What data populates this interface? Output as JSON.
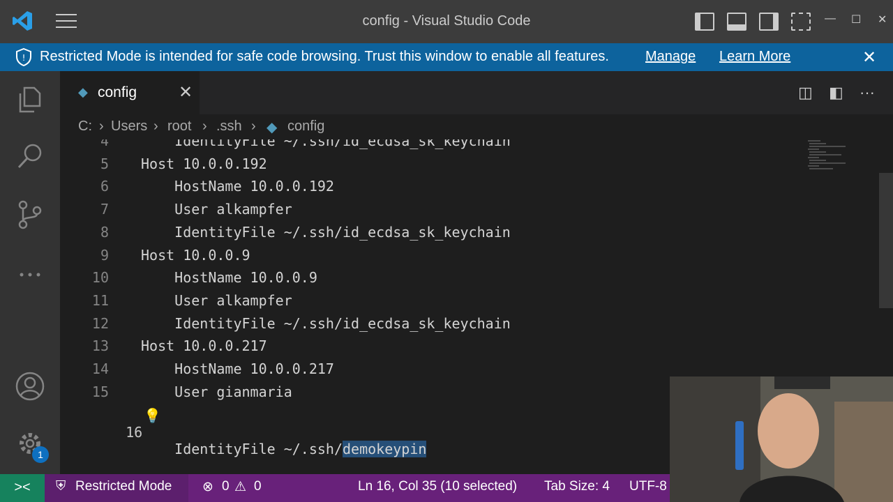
{
  "window": {
    "title": "config - Visual Studio Code"
  },
  "banner": {
    "message": "Restricted Mode is intended for safe code browsing. Trust this window to enable all features.",
    "manage": "Manage",
    "learn_more": "Learn More"
  },
  "tab": {
    "name": "config"
  },
  "breadcrumb": {
    "drive": "C:",
    "users": "Users",
    "root": "root",
    "ssh": ".ssh",
    "file": "config"
  },
  "editor": {
    "lines": [
      {
        "num": "4",
        "text": "    IdentityFile ~/.ssh/id_ecdsa_sk_keychain"
      },
      {
        "num": "5",
        "text": "Host 10.0.0.192"
      },
      {
        "num": "6",
        "text": "    HostName 10.0.0.192"
      },
      {
        "num": "7",
        "text": "    User alkampfer"
      },
      {
        "num": "8",
        "text": "    IdentityFile ~/.ssh/id_ecdsa_sk_keychain"
      },
      {
        "num": "9",
        "text": "Host 10.0.0.9"
      },
      {
        "num": "10",
        "text": "    HostName 10.0.0.9"
      },
      {
        "num": "11",
        "text": "    User alkampfer"
      },
      {
        "num": "12",
        "text": "    IdentityFile ~/.ssh/id_ecdsa_sk_keychain"
      },
      {
        "num": "13",
        "text": "Host 10.0.0.217"
      },
      {
        "num": "14",
        "text": "    HostName 10.0.0.217"
      },
      {
        "num": "15",
        "text": "    User gianmaria"
      }
    ],
    "last_line": {
      "num": "16",
      "prefix": "    IdentityFile ~/.ssh/",
      "selected": "demokeypin"
    }
  },
  "activity": {
    "settings_badge": "1"
  },
  "status": {
    "restricted": "Restricted Mode",
    "errors": "0",
    "warnings": "0",
    "position": "Ln 16, Col 35 (10 selected)",
    "tab_size": "Tab Size: 4",
    "encoding": "UTF-8"
  },
  "colors": {
    "title_bar": "#3c3c3c",
    "banner": "#0d639d",
    "activity_bar": "#333333",
    "editor_bg": "#1e1e1e",
    "status_bar": "#68217a",
    "remote": "#16825d",
    "selection": "#264f78"
  }
}
